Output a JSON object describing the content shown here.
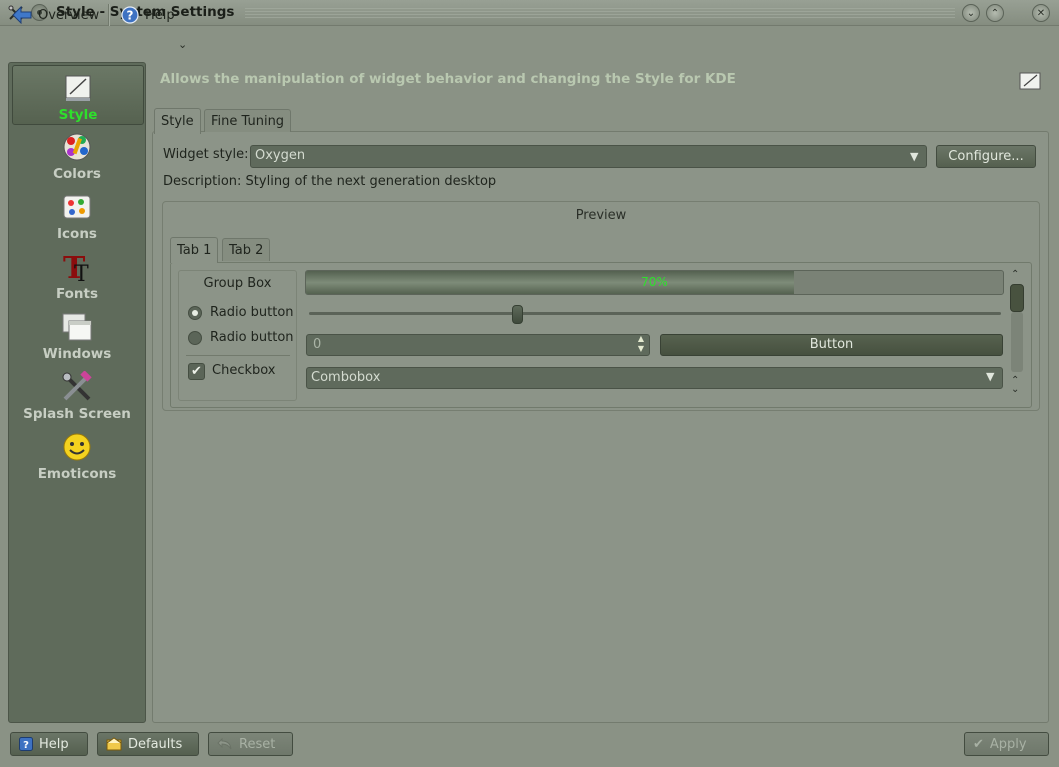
{
  "window": {
    "title": "Style - System Settings"
  },
  "toolbar": {
    "overview": "Overview",
    "help": "Help"
  },
  "sidebar": {
    "items": [
      {
        "label": "Style",
        "icon": "style-icon",
        "active": true
      },
      {
        "label": "Colors",
        "icon": "colors-icon"
      },
      {
        "label": "Icons",
        "icon": "icons-icon"
      },
      {
        "label": "Fonts",
        "icon": "fonts-icon"
      },
      {
        "label": "Windows",
        "icon": "windows-icon"
      },
      {
        "label": "Splash Screen",
        "icon": "splash-screen-icon"
      },
      {
        "label": "Emoticons",
        "icon": "emoticons-icon"
      }
    ]
  },
  "header": {
    "description": "Allows the manipulation of widget behavior and changing the Style for KDE"
  },
  "tabs": {
    "style": "Style",
    "fine_tuning": "Fine Tuning"
  },
  "widget_style": {
    "label": "Widget style:",
    "value": "Oxygen",
    "configure": "Configure...",
    "description": "Description: Styling of the next generation desktop"
  },
  "preview": {
    "title": "Preview",
    "tab1": "Tab 1",
    "tab2": "Tab 2",
    "group_box": "Group Box",
    "radio1": "Radio button",
    "radio2": "Radio button",
    "checkbox": "Checkbox",
    "progress_text": "70%",
    "progress_value": 0.7,
    "slider_value": 0.3,
    "spin_value": "0",
    "button": "Button",
    "combobox": "Combobox"
  },
  "bottom": {
    "help": "Help",
    "defaults": "Defaults",
    "reset": "Reset",
    "apply": "Apply"
  },
  "colors": {
    "accent_green": "#2ee02c",
    "sidebar_bg": "#5f6b5b",
    "window_bg": "#8a9285"
  }
}
